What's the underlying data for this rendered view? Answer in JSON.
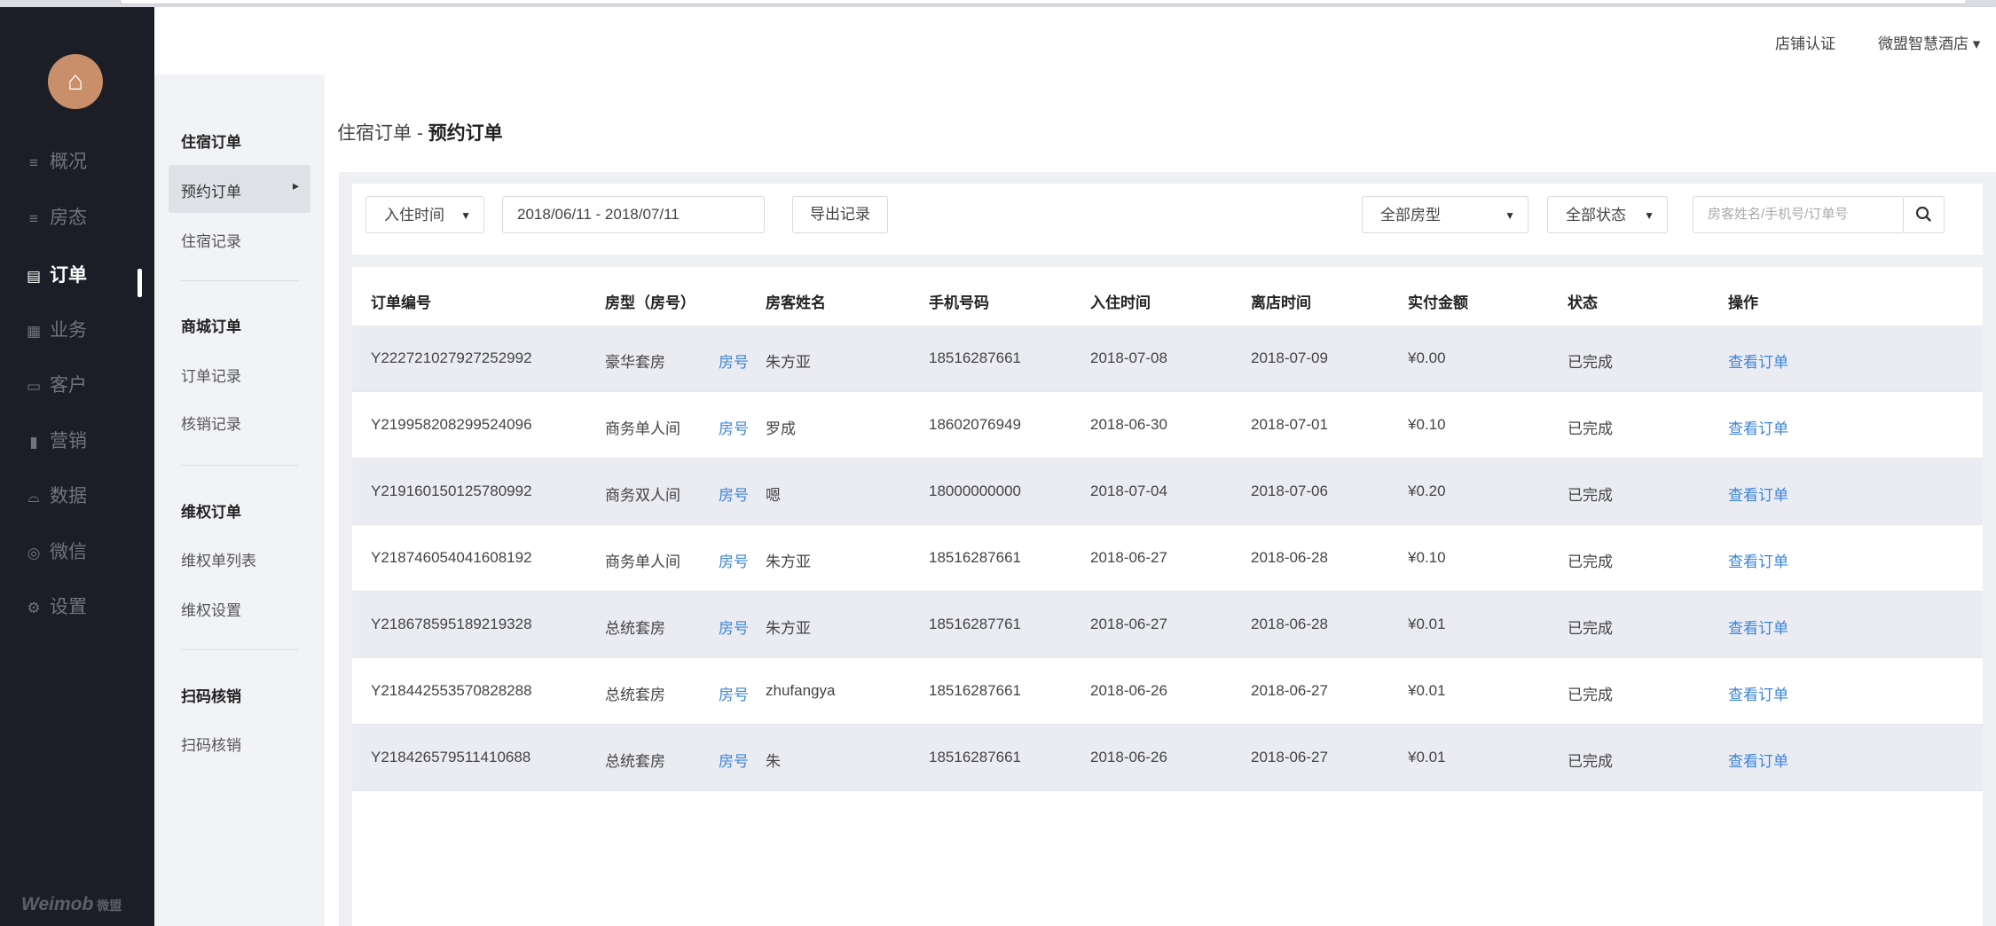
{
  "nav": {
    "items": [
      {
        "icon": "≡",
        "label": "概况",
        "name": "overview"
      },
      {
        "icon": "≡",
        "label": "房态",
        "name": "room-status"
      },
      {
        "icon": "▤",
        "label": "订单",
        "name": "orders"
      },
      {
        "icon": "▦",
        "label": "业务",
        "name": "business"
      },
      {
        "icon": "▭",
        "label": "客户",
        "name": "customers"
      },
      {
        "icon": "▮",
        "label": "营销",
        "name": "marketing"
      },
      {
        "icon": "⌓",
        "label": "数据",
        "name": "data"
      },
      {
        "icon": "◎",
        "label": "微信",
        "name": "wechat"
      },
      {
        "icon": "⚙",
        "label": "设置",
        "name": "settings"
      }
    ],
    "brand": "Weimob",
    "brand_cn": "微盟"
  },
  "header": {
    "store_cert": "店铺认证",
    "store_name": "微盟智慧酒店",
    "caret": "▾"
  },
  "subnav": {
    "group1": "住宿订单",
    "item_active": "预约订单",
    "active_arrow": "▸",
    "item_records": "住宿记录",
    "group2": "商城订单",
    "item_order_records": "订单记录",
    "item_verify_records": "核销记录",
    "group3": "维权订单",
    "item_rights_list": "维权单列表",
    "item_rights_settings": "维权设置",
    "group4": "扫码核销",
    "item_scan": "扫码核销"
  },
  "breadcrumb": {
    "parent": "住宿订单",
    "sep": " - ",
    "current": "预约订单"
  },
  "filter": {
    "time_type": "入住时间",
    "date_range": "2018/06/11 - 2018/07/11",
    "export": "导出记录",
    "room_type": "全部房型",
    "status": "全部状态",
    "search_placeholder": "房客姓名/手机号/订单号",
    "arrow": "▼"
  },
  "table": {
    "headers": {
      "order_no": "订单编号",
      "room_type": "房型（房号）",
      "guest": "房客姓名",
      "phone": "手机号码",
      "checkin": "入住时间",
      "checkout": "离店时间",
      "amount": "实付金额",
      "status": "状态",
      "action": "操作"
    },
    "rows": [
      {
        "order_no": "Y222721027927252992",
        "room_type": "豪华套房",
        "room_no": "房号",
        "guest": "朱方亚",
        "phone": "18516287661",
        "checkin": "2018-07-08",
        "checkout": "2018-07-09",
        "amount": "¥0.00",
        "status": "已完成",
        "action": "查看订单"
      },
      {
        "order_no": "Y219958208299524096",
        "room_type": "商务单人间",
        "room_no": "房号",
        "guest": "罗成",
        "phone": "18602076949",
        "checkin": "2018-06-30",
        "checkout": "2018-07-01",
        "amount": "¥0.10",
        "status": "已完成",
        "action": "查看订单"
      },
      {
        "order_no": "Y219160150125780992",
        "room_type": "商务双人间",
        "room_no": "房号",
        "guest": "嗯",
        "phone": "18000000000",
        "checkin": "2018-07-04",
        "checkout": "2018-07-06",
        "amount": "¥0.20",
        "status": "已完成",
        "action": "查看订单"
      },
      {
        "order_no": "Y218746054041608192",
        "room_type": "商务单人间",
        "room_no": "房号",
        "guest": "朱方亚",
        "phone": "18516287661",
        "checkin": "2018-06-27",
        "checkout": "2018-06-28",
        "amount": "¥0.10",
        "status": "已完成",
        "action": "查看订单"
      },
      {
        "order_no": "Y218678595189219328",
        "room_type": "总统套房",
        "room_no": "房号",
        "guest": "朱方亚",
        "phone": "18516287761",
        "checkin": "2018-06-27",
        "checkout": "2018-06-28",
        "amount": "¥0.01",
        "status": "已完成",
        "action": "查看订单"
      },
      {
        "order_no": "Y218442553570828288",
        "room_type": "总统套房",
        "room_no": "房号",
        "guest": "zhufangya",
        "phone": "18516287661",
        "checkin": "2018-06-26",
        "checkout": "2018-06-27",
        "amount": "¥0.01",
        "status": "已完成",
        "action": "查看订单"
      },
      {
        "order_no": "Y218426579511410688",
        "room_type": "总统套房",
        "room_no": "房号",
        "guest": "朱",
        "phone": "18516287661",
        "checkin": "2018-06-26",
        "checkout": "2018-06-27",
        "amount": "¥0.01",
        "status": "已完成",
        "action": "查看订单"
      }
    ]
  }
}
